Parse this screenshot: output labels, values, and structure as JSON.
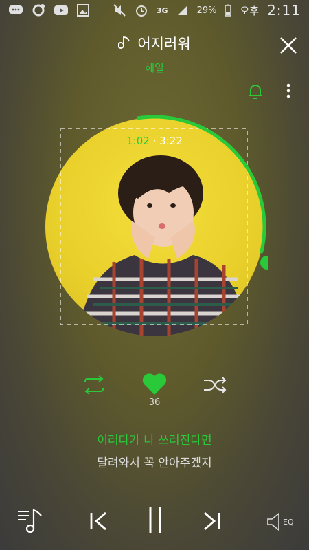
{
  "status_bar": {
    "battery": "29%",
    "ampm": "오후",
    "time": "2:11",
    "network": "3G"
  },
  "song": {
    "title": "어지러워",
    "artist": "헤일"
  },
  "player": {
    "current_time": "1:02",
    "separator": "·",
    "total_time": "3:22",
    "progress": 0.31,
    "like_count": "36"
  },
  "lyrics": {
    "current": "이러다가 나 쓰러진다면",
    "next": "달려와서 꼭 안아주겠지"
  },
  "eq": {
    "label": "EQ"
  },
  "colors": {
    "accent": "#29c93a",
    "album_bg": "#f0d535",
    "background": "#5e5a2c"
  },
  "icons": [
    "music-note-icon",
    "close-icon",
    "bell-icon",
    "more-vertical-icon",
    "repeat-icon",
    "heart-icon",
    "shuffle-icon",
    "playlist-icon",
    "previous-icon",
    "pause-icon",
    "next-icon",
    "speaker-eq-icon"
  ]
}
